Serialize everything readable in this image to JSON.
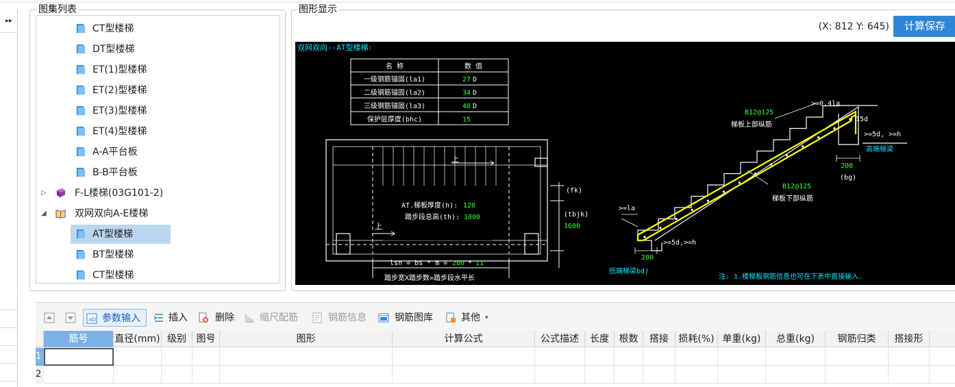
{
  "panels": {
    "atlas_title": "图集列表",
    "graphic_title": "图形显示"
  },
  "tree": {
    "items": [
      {
        "label": "CT型楼梯",
        "kind": "leaf",
        "selected": false
      },
      {
        "label": "DT型楼梯",
        "kind": "leaf",
        "selected": false
      },
      {
        "label": "ET(1)型楼梯",
        "kind": "leaf",
        "selected": false
      },
      {
        "label": "ET(2)型楼梯",
        "kind": "leaf",
        "selected": false
      },
      {
        "label": "ET(3)型楼梯",
        "kind": "leaf",
        "selected": false
      },
      {
        "label": "ET(4)型楼梯",
        "kind": "leaf",
        "selected": false
      },
      {
        "label": "A-A平台板",
        "kind": "leaf",
        "selected": false
      },
      {
        "label": "B-B平台板",
        "kind": "leaf",
        "selected": false
      },
      {
        "label": "F-L楼梯(03G101-2)",
        "kind": "book-collapsed",
        "selected": false
      },
      {
        "label": "双网双向A-E楼梯",
        "kind": "book-expanded",
        "selected": false
      },
      {
        "label": "AT型楼梯",
        "kind": "leaf",
        "selected": true
      },
      {
        "label": "BT型楼梯",
        "kind": "leaf",
        "selected": false
      },
      {
        "label": "CT型楼梯",
        "kind": "leaf",
        "selected": false
      }
    ]
  },
  "graphic": {
    "coords": "(X: 812 Y: 645)",
    "calc_save": "计算保存",
    "drawing": {
      "title": "双网双向--AT型楼梯:",
      "table_header_name": "名 称",
      "table_header_value": "数 值",
      "table_rows": [
        {
          "name": "一级钢筋锚固(la1)",
          "value": "27",
          "unit": "D"
        },
        {
          "name": "二级钢筋锚固(la2)",
          "value": "34",
          "unit": "D"
        },
        {
          "name": "三级钢筋锚固(la3)",
          "value": "40",
          "unit": "D"
        },
        {
          "name": "保护层厚度(bhc)",
          "value": "15",
          "unit": ""
        }
      ],
      "up_label": "上",
      "plate_thickness_label": "AT.梯板厚度(h):",
      "plate_thickness_value": "120",
      "step_height_label": "踏步段总高(th):",
      "step_height_value": "1800",
      "fk_label": "(fk)",
      "tbjk_label": "(tbjk)",
      "tbjk_value": "1600",
      "lsn_formula": "lsn = bs * m = ",
      "bs_value": "280",
      "m_value": "11",
      "step_note": "踏步宽X踏步数=踏步段水平长",
      "top_bar_label": "B12@125",
      "top_bar_desc": "梯板上部纵筋",
      "bottom_bar_label": "B12@125",
      "bottom_bar_desc": "梯板下部纵筋",
      "ge_041_la": ">=0.4la",
      "top_15d": "15d",
      "ge_5d_h_top": ">=5d, >=h",
      "high_end_beam": "高端梯梁",
      "top_200": "200",
      "bg_label": "(bg)",
      "ge_la": ">=la",
      "ge_5d_h_bottom": ">=5d,>=h",
      "bottom_200": "200",
      "low_end_beam": "低端梯梁bd)",
      "note": "注: 1.楼梯板钢筋信息也可在下表中直接输入."
    }
  },
  "toolbar": {
    "up_icon": "move-up-icon",
    "down_icon": "move-down-icon",
    "param_input": "参数输入",
    "insert": "插入",
    "delete": "删除",
    "scale_rebar": "缩尺配筋",
    "rebar_info": "钢筋信息",
    "rebar_library": "钢筋图库",
    "other": "其他"
  },
  "grid": {
    "columns": [
      "筋号",
      "直径(mm)",
      "级别",
      "图号",
      "图形",
      "计算公式",
      "公式描述",
      "长度",
      "根数",
      "搭接",
      "损耗(%)",
      "单重(kg)",
      "总重(kg)",
      "钢筋归类",
      "搭接形"
    ],
    "rows": [
      {
        "num": "1"
      },
      {
        "num": "2"
      }
    ]
  },
  "colors": {
    "accent": "#2f86d8",
    "selection": "#bcd6ef",
    "drawing_bg": "#000000",
    "drawing_line": "#ffffff",
    "drawing_value": "#33ff33",
    "drawing_label": "#00e5ff",
    "rebar": "#ffff00"
  }
}
